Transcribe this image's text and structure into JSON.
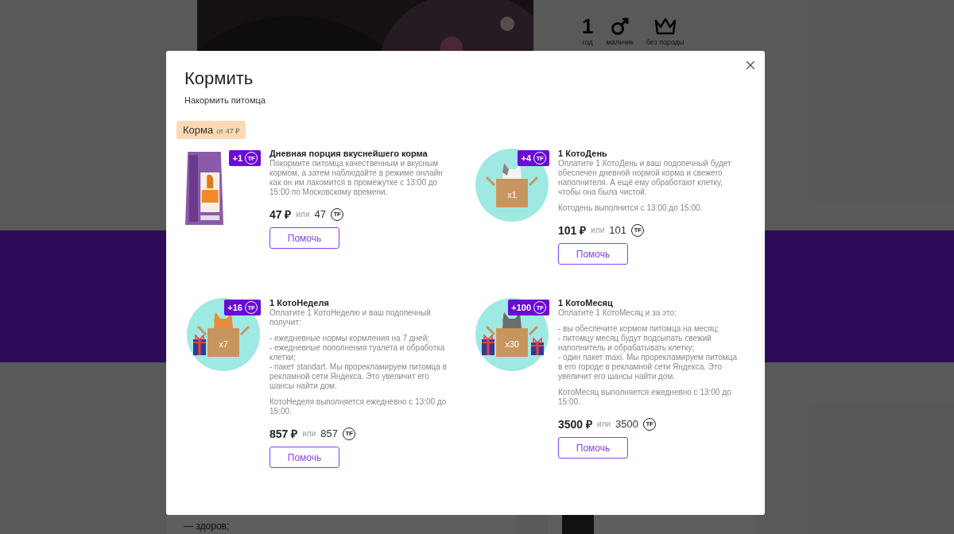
{
  "background_page": {
    "stats": [
      {
        "value": "1",
        "label": "год",
        "kind": "number"
      },
      {
        "label": "мальчик",
        "kind": "male"
      },
      {
        "label": "без породы",
        "kind": "crown"
      }
    ],
    "bottom_text": "— здоров;"
  },
  "modal": {
    "title": "Кормить",
    "subtitle": "Накормить питомца",
    "category": {
      "name": "Корма",
      "price_from": "от 47 ₽"
    },
    "items": [
      {
        "kind": "bag",
        "title": "Дневная порция вкуснейшего корма",
        "paragraphs": [
          "Покормите питомца качественным и вкусным кормом, а затем наблюдайте в режиме онлайн как он им лакомится в промежутке с 13:00 до 15:00 по Московскому времени."
        ],
        "badge": {
          "amount": "+1",
          "coin": "TF"
        },
        "price": {
          "rub": "47 ₽",
          "or": "или",
          "coins": "47",
          "coin": "TF"
        },
        "button": "Помочь"
      },
      {
        "kind": "box",
        "box_label": "x1",
        "title": "1 КотоДень",
        "paragraphs": [
          "Оплатите 1 КотоДень и ваш подопечный будет обеспечен дневной нормой корма и свежего наполнителя. А ещё ему обработают клетку, чтобы она была чистой.",
          "Котодень выполнится с 13:00 до 15:00."
        ],
        "badge": {
          "amount": "+4",
          "coin": "TF"
        },
        "price": {
          "rub": "101 ₽",
          "or": "или",
          "coins": "101",
          "coin": "TF"
        },
        "button": "Помочь"
      },
      {
        "kind": "box_gift",
        "box_label": "x7",
        "title": "1 КотоНеделя",
        "paragraphs": [
          "Оплатите 1 КотоНеделю и ваш подопечный получит:",
          "- ежедневные нормы кормления на 7 дней;\n- ежедневные пополнения туалета и обработка клетки;\n- пакет standart. Мы прорекламируем питомца в рекламной сети Яндекса. Это увеличит его шансы найти дом.",
          "КотоНеделя выполняется ежедневно с 13:00 до 15:00."
        ],
        "badge": {
          "amount": "+16",
          "coin": "TF"
        },
        "price": {
          "rub": "857 ₽",
          "or": "или",
          "coins": "857",
          "coin": "TF"
        },
        "button": "Помочь"
      },
      {
        "kind": "box_gifts",
        "box_label": "x30",
        "title": "1 КотоМесяц",
        "paragraphs": [
          "Оплатите 1 КотоМесяц  и за это:",
          "- вы обеспечите кормом питомца на месяц;\n- питомцу месяц будут подсыпать свежий наполнитель и обрабатывать клетку;\n- один пакет maxi. Мы прорекламируем питомца в его городе в рекламной сети Яндекса. Это увеличит его шансы найти дом.",
          "КотоМесяц выполняется ежедневно с 13:00 до 15:00."
        ],
        "badge": {
          "amount": "+100",
          "coin": "TF"
        },
        "price": {
          "rub": "3500 ₽",
          "or": "или",
          "coins": "3500",
          "coin": "TF"
        },
        "button": "Помочь"
      }
    ]
  }
}
